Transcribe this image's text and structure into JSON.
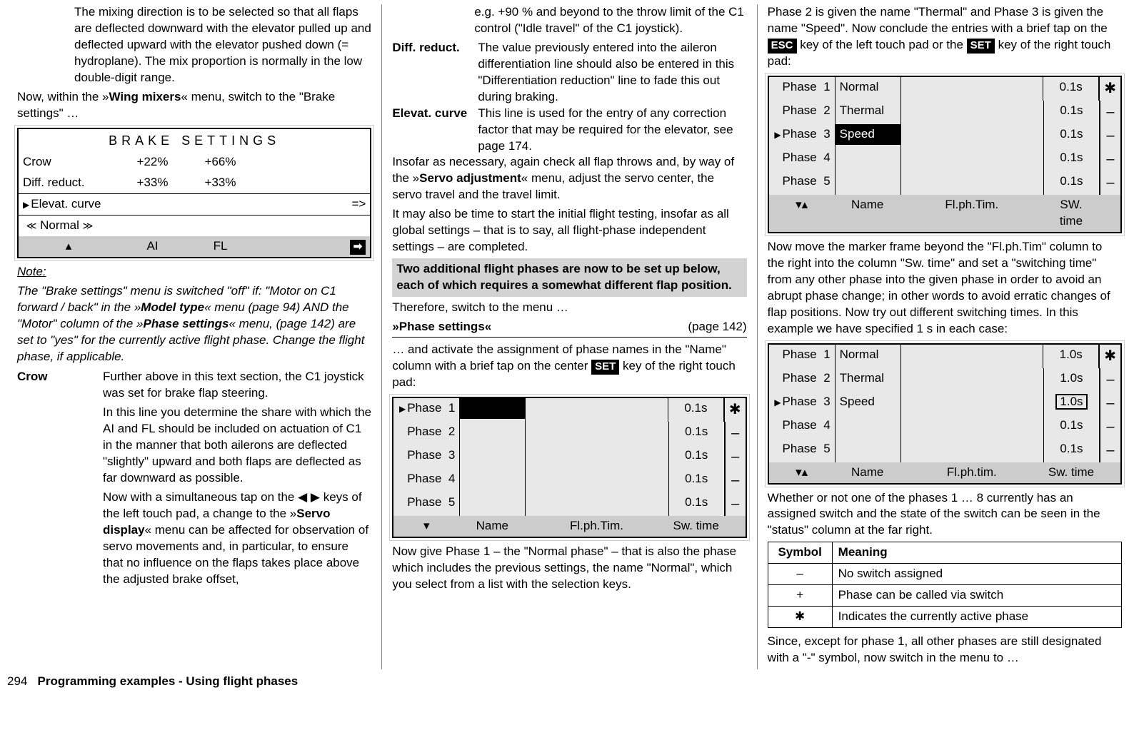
{
  "col1": {
    "p1": "The mixing direction is to be selected so that all flaps are deflected downward with the elevator pulled up and deflected upward with the elevator pushed down (= hydroplane). The mix proportion is normally in the low double-digit range.",
    "p2a": "Now, within the »",
    "p2b": "Wing mixers",
    "p2c": "« menu, switch to the \"Brake settings\" …",
    "brake": {
      "title": "BRAKE SETTINGS",
      "rows": [
        {
          "label": "Crow",
          "v1": "+22%",
          "v2": "+66%"
        },
        {
          "label": "Diff. reduct.",
          "v1": "+33%",
          "v2": "+33%"
        }
      ],
      "elevat": "Elevat. curve",
      "arrow": "=>",
      "normal": "Normal",
      "foot_ai": "AI",
      "foot_fl": "FL"
    },
    "note_hdr": "Note:",
    "note1": "The \"Brake settings\" menu is switched \"off\" if: \"Motor on C1 forward / back\" in the »",
    "note2": "Model type",
    "note3": "« menu (page 94) AND the \"Motor\" column of the »",
    "note4": "Phase settings",
    "note5": "« menu, (page 142) are set to \"yes\" for the currently active flight phase. Change the flight phase, if applicable.",
    "crow_label": "Crow",
    "crow1": "Further above in this text section, the C1 joystick was set for brake flap steering.",
    "crow2": "In this line you determine the share with which the AI and FL should be included on actuation of C1 in the manner that both ailerons are deflected \"slightly\" upward and both flaps are deflected as far downward as possible.",
    "crow3a": "Now with a simultaneous tap on the ◀ ▶ keys of the left touch pad, a change to the »",
    "crow3b": "Servo display",
    "crow3c": "« menu can be affected for observation of servo movements and, in particular, to ensure that no influence on the flaps takes place above the adjusted brake offset,"
  },
  "col2": {
    "p0": "e.g. +90 % and beyond to the throw limit of the C1 control (\"Idle travel\" of the C1 joystick).",
    "diff_label": "Diff. reduct.",
    "diff_text": "The value previously entered into the aileron differentiation line should also be entered in this \"Differentiation reduction\" line to fade this out during braking.",
    "elev_label": "Elevat. curve",
    "elev_text": "This line is used for the entry of any correction factor that may be required for the elevator, see page 174.",
    "p3a": "Insofar as necessary, again check all flap throws and, by way of the »",
    "p3b": "Servo adjustment",
    "p3c": "« menu, adjust the servo center, the servo travel and the travel limit.",
    "p4": "It may also be time to start the initial flight testing, insofar as all global settings – that is to say, all flight-phase independent settings – are completed.",
    "hl": "Two additional flight phases are now to be set up below, each of which requires a somewhat different flap position.",
    "p5": "Therefore, switch to the menu …",
    "menu_name": "»Phase settings«",
    "menu_page": "(page 142)",
    "p6a": "… and activate the assignment of phase names in the \"Name\" column with a brief tap on the center ",
    "p6b": "SET",
    "p6c": " key of the right touch pad:",
    "table": {
      "rows": [
        {
          "ph": "Phase  1",
          "name": "",
          "sw": "0.1s",
          "st": "✱",
          "sel": true
        },
        {
          "ph": "Phase  2",
          "name": "",
          "sw": "0.1s",
          "st": "–"
        },
        {
          "ph": "Phase  3",
          "name": "",
          "sw": "0.1s",
          "st": "–"
        },
        {
          "ph": "Phase  4",
          "name": "",
          "sw": "0.1s",
          "st": "–"
        },
        {
          "ph": "Phase  5",
          "name": "",
          "sw": "0.1s",
          "st": "–"
        }
      ],
      "foot_name": "Name",
      "foot_fl": "Fl.ph.Tim.",
      "foot_sw": "Sw. time"
    },
    "p7": "Now give Phase 1 – the \"Normal phase\" – that is also the phase which includes the previous settings, the name \"Normal\", which you select from a list with the selection keys."
  },
  "col3": {
    "p1a": "Phase 2 is given the name \"Thermal\" and Phase 3 is given the name \"Speed\". Now conclude the entries with a brief tap on the ",
    "p1b": "ESC",
    "p1c": " key of the left touch pad or the ",
    "p1d": "SET",
    "p1e": " key of the right touch pad:",
    "table1": {
      "rows": [
        {
          "ph": "Phase  1",
          "name": "Normal",
          "sw": "0.1s",
          "st": "✱"
        },
        {
          "ph": "Phase  2",
          "name": "Thermal",
          "sw": "0.1s",
          "st": "–"
        },
        {
          "ph": "Phase  3",
          "name": "Speed",
          "sw": "0.1s",
          "st": "–",
          "sel": true,
          "invert": true
        },
        {
          "ph": "Phase  4",
          "name": "",
          "sw": "0.1s",
          "st": "–"
        },
        {
          "ph": "Phase  5",
          "name": "",
          "sw": "0.1s",
          "st": "–"
        }
      ],
      "foot_name": "Name",
      "foot_fl": "Fl.ph.Tim.",
      "foot_sw": "SW. time"
    },
    "p2": "Now move the marker frame beyond the \"Fl.ph.Tim\" column to the right into the column \"Sw. time\" and set a \"switching time\" from any other phase into the given phase in order to avoid an abrupt phase change; in other words to avoid erratic changes of flap positions. Now try out different switching times. In this example we have specified 1 s in each case:",
    "table2": {
      "rows": [
        {
          "ph": "Phase  1",
          "name": "Normal",
          "sw": "1.0s",
          "st": "✱"
        },
        {
          "ph": "Phase  2",
          "name": "Thermal",
          "sw": "1.0s",
          "st": "–"
        },
        {
          "ph": "Phase  3",
          "name": "Speed",
          "sw": "1.0s",
          "st": "–",
          "sel": true,
          "box": true
        },
        {
          "ph": "Phase  4",
          "name": "",
          "sw": "0.1s",
          "st": "–"
        },
        {
          "ph": "Phase  5",
          "name": "",
          "sw": "0.1s",
          "st": "–"
        }
      ],
      "foot_name": "Name",
      "foot_fl": "Fl.ph.tim.",
      "foot_sw": "Sw. time"
    },
    "p3": "Whether or not one of the phases 1 … 8 currently has an assigned switch and the state of the switch can be seen in the \"status\" column at the far right.",
    "sym_hdr1": "Symbol",
    "sym_hdr2": "Meaning",
    "syms": [
      {
        "s": "–",
        "m": "No switch assigned"
      },
      {
        "s": "+",
        "m": "Phase can be called via switch"
      },
      {
        "s": "✱",
        "m": "Indicates the currently active phase"
      }
    ],
    "p4": "Since, except for phase 1, all other phases are still designated with a \"-\" symbol, now switch in the menu to …"
  },
  "footer": {
    "page": "294",
    "title": "Programming examples - Using flight phases"
  }
}
